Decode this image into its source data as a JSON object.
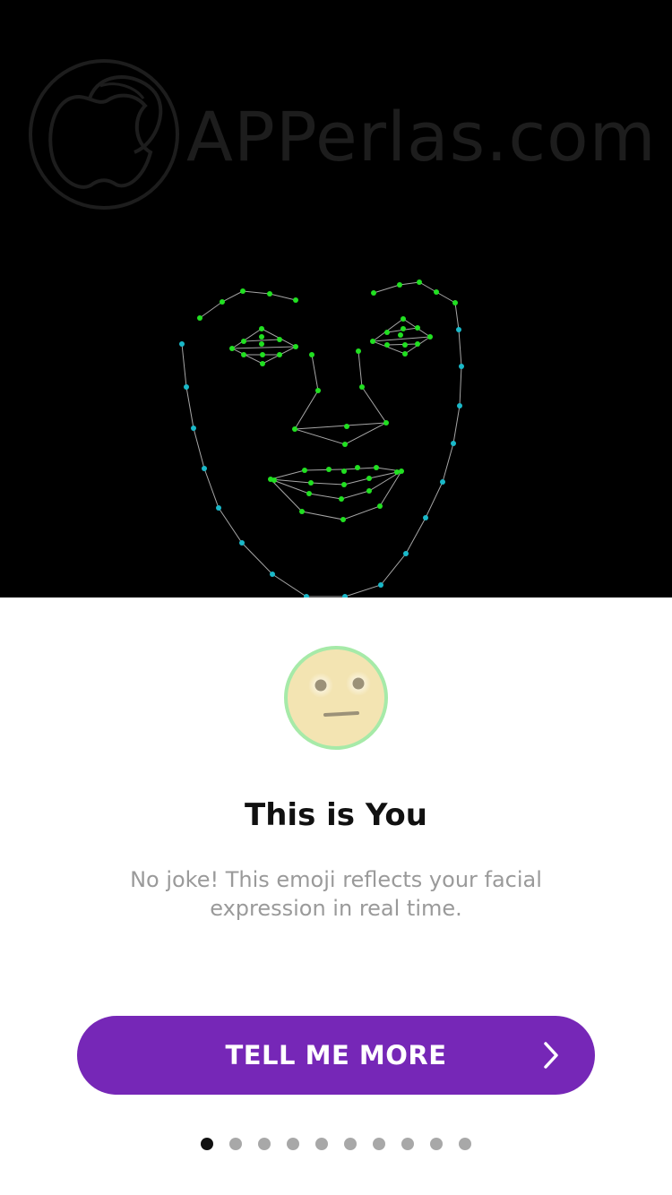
{
  "camera": {
    "watermark": "APPerlas.com",
    "landmark_color": "#21e021",
    "outline_color": "#1ab9c9"
  },
  "onboarding": {
    "title": "This is You",
    "description": "No joke! This emoji reflects your facial expression in real time.",
    "cta_label": "TELL ME MORE",
    "cta_icon": "chevron-right-icon",
    "emoji_icon": "neutral-face-emoji",
    "page_count": 10,
    "current_page": 1
  },
  "colors": {
    "accent": "#7627b7",
    "dot_active": "#111111",
    "dot_inactive": "#a8a8a8",
    "emoji_fill": "#f3e4b2",
    "emoji_border": "#a6eaa8"
  }
}
